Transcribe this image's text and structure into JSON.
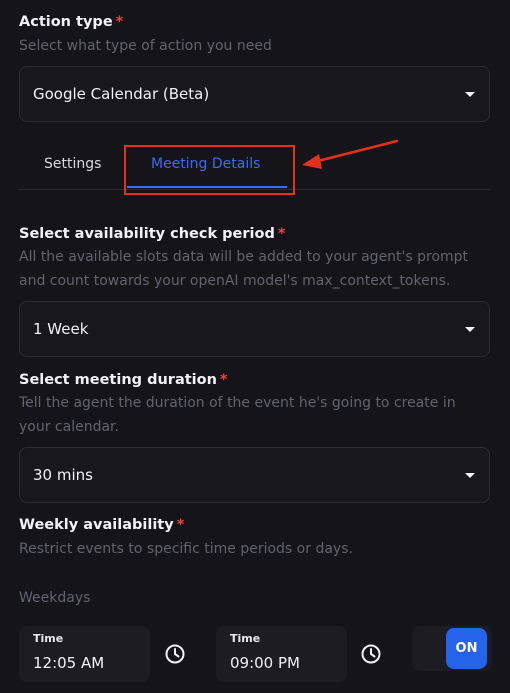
{
  "action_type": {
    "label": "Action type",
    "required_mark": "*",
    "help": "Select what type of action you need",
    "selected": "Google Calendar (Beta)"
  },
  "tabs": [
    {
      "label": "Settings",
      "active": false
    },
    {
      "label": "Meeting Details",
      "active": true
    }
  ],
  "availability_period": {
    "label": "Select availability check period",
    "required_mark": "*",
    "help_line1": "All the available slots data will be added to your agent's prompt",
    "help_line2": "and count towards your openAI model's max_context_tokens.",
    "selected": "1 Week"
  },
  "meeting_duration": {
    "label": "Select meeting duration",
    "required_mark": "*",
    "help_line1": "Tell the agent the duration of the event he's going to create in",
    "help_line2": "your calendar.",
    "selected": "30 mins"
  },
  "weekly_availability": {
    "label": "Weekly availability",
    "required_mark": "*",
    "help": "Restrict events to specific time periods or days.",
    "group_label": "Weekdays",
    "start": {
      "caption": "Time",
      "value": "12:05 AM"
    },
    "end": {
      "caption": "Time",
      "value": "09:00 PM"
    },
    "toggle_label": "ON"
  },
  "colors": {
    "background": "#141419",
    "accent": "#3b6cf6",
    "toggle": "#2563eb",
    "required": "#ef4444",
    "annotation": "#e5311c"
  },
  "icons": [
    "clock-icon",
    "chevron-down-icon",
    "arrow-annotation"
  ]
}
